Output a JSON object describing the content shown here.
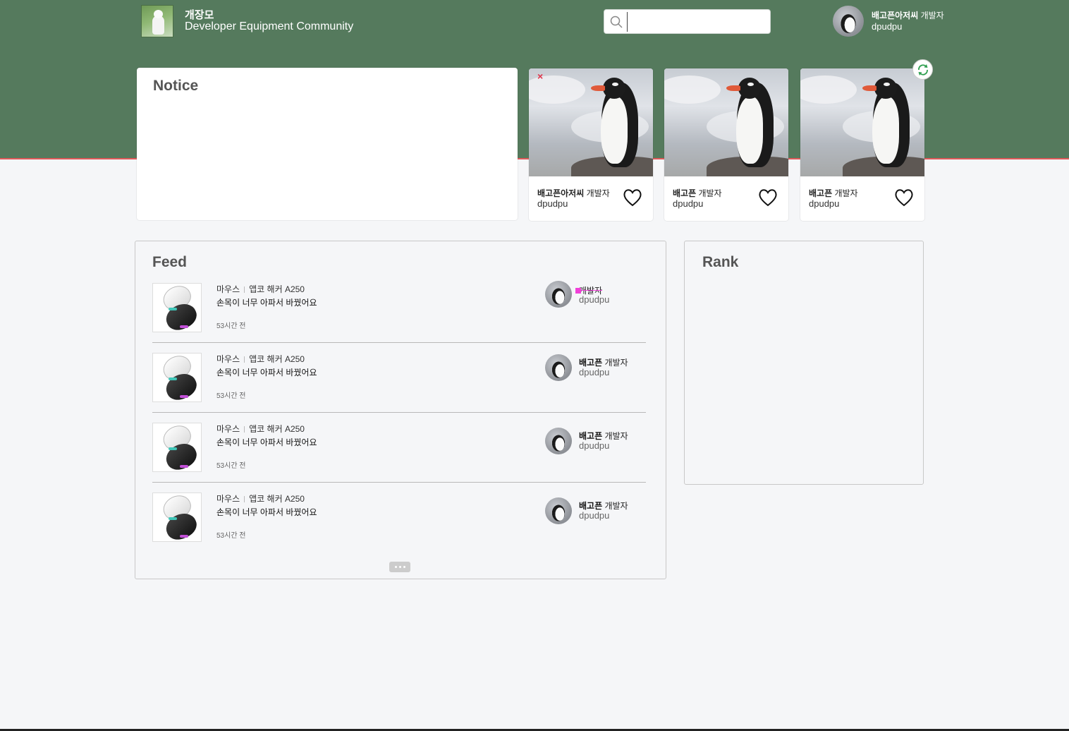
{
  "header": {
    "brand_name": "개장모",
    "brand_subtitle": "Developer Equipment Community",
    "search_placeholder": "",
    "user": {
      "nickname": "배고픈아저씨",
      "role": "개발자",
      "id": "dpudpu"
    }
  },
  "notice": {
    "title": "Notice"
  },
  "cards": [
    {
      "nickname": "배고픈아저씨",
      "role": "개발자",
      "id": "dpudpu"
    },
    {
      "nickname": "배고픈",
      "role": "개발자",
      "id": "dpudpu"
    },
    {
      "nickname": "배고픈",
      "role": "개발자",
      "id": "dpudpu"
    }
  ],
  "close_glyph": "×",
  "feed": {
    "title": "Feed",
    "items": [
      {
        "category": "마우스",
        "product": "앱코 해커 A250",
        "text": "손목이 너무 아파서 바꿨어요",
        "time": "53시간 전",
        "nickname": "",
        "role": "개발자",
        "id": "dpudpu"
      },
      {
        "category": "마우스",
        "product": "앱코 해커 A250",
        "text": "손목이 너무 아파서 바꿨어요",
        "time": "53시간 전",
        "nickname": "배고픈",
        "role": "개발자",
        "id": "dpudpu"
      },
      {
        "category": "마우스",
        "product": "앱코 해커 A250",
        "text": "손목이 너무 아파서 바꿨어요",
        "time": "53시간 전",
        "nickname": "배고픈",
        "role": "개발자",
        "id": "dpudpu"
      },
      {
        "category": "마우스",
        "product": "앱코 해커 A250",
        "text": "손목이 너무 아파서 바꿨어요",
        "time": "53시간 전",
        "nickname": "배고픈",
        "role": "개발자",
        "id": "dpudpu"
      }
    ]
  },
  "rank": {
    "title": "Rank"
  },
  "colors": {
    "header_bg": "#557a5d",
    "accent_red": "#e05a5a",
    "page_bg": "#f5f6f8",
    "refresh_green": "#2e9e4f"
  }
}
